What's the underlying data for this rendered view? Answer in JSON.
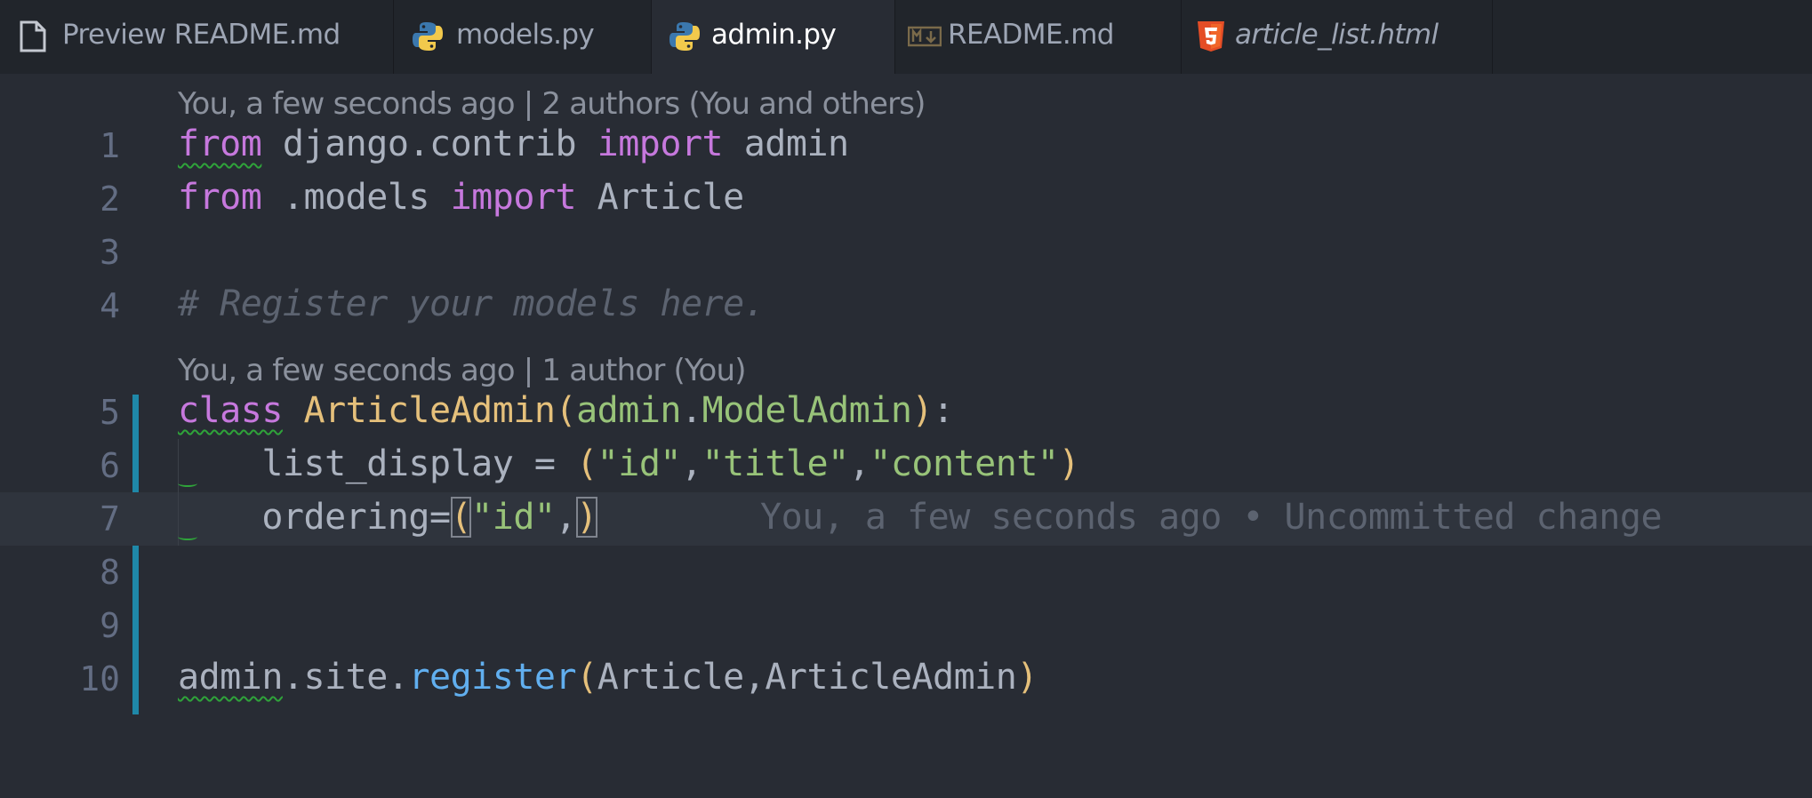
{
  "tabs": [
    {
      "label": "Preview README.md",
      "icon": "file-icon",
      "active": false,
      "italic": false
    },
    {
      "label": "models.py",
      "icon": "python-icon",
      "active": false,
      "italic": false
    },
    {
      "label": "admin.py",
      "icon": "python-icon",
      "active": true,
      "italic": false
    },
    {
      "label": "README.md",
      "icon": "markdown-icon",
      "active": false,
      "italic": false
    },
    {
      "label": "article_list.html",
      "icon": "html5-icon",
      "active": false,
      "italic": true
    }
  ],
  "codelens": {
    "top": "You, a few seconds ago | 2 authors (You and others)",
    "middle": "You, a few seconds ago | 1 author (You)"
  },
  "line_numbers": [
    "1",
    "2",
    "3",
    "4",
    "5",
    "6",
    "7",
    "8",
    "9",
    "10"
  ],
  "code": {
    "l1": {
      "from": "from",
      "module": " django.contrib ",
      "import": "import",
      "name": " admin"
    },
    "l2": {
      "from": "from",
      "module": " .models ",
      "import": "import",
      "name": " Article"
    },
    "l4": {
      "comment": "# Register your models here."
    },
    "l5": {
      "class": "class",
      "name": " ArticleAdmin",
      "open": "(",
      "base_mod": "admin",
      "dot": ".",
      "base": "ModelAdmin",
      "close": ")",
      "colon": ":"
    },
    "l6": {
      "indent": "    ",
      "attr": "list_display = ",
      "open": "(",
      "s1": "\"id\"",
      "c1": ",",
      "s2": "\"title\"",
      "c2": ",",
      "s3": "\"content\"",
      "close": ")"
    },
    "l7": {
      "indent": "    ",
      "attr": "ordering=",
      "open": "(",
      "s1": "\"id\"",
      "c1": ",",
      "close": ")"
    },
    "l10": {
      "obj": "admin",
      "d1": ".",
      "site": "site",
      "d2": ".",
      "fn": "register",
      "open": "(",
      "args": "Article,ArticleAdmin",
      "close": ")"
    }
  },
  "blame": "You, a few seconds ago • Uncommitted change",
  "colors": {
    "keyword": "#c678dd",
    "class": "#e5c07b",
    "string": "#98c379",
    "function": "#61afef",
    "git_bar": "#1f88a8"
  }
}
